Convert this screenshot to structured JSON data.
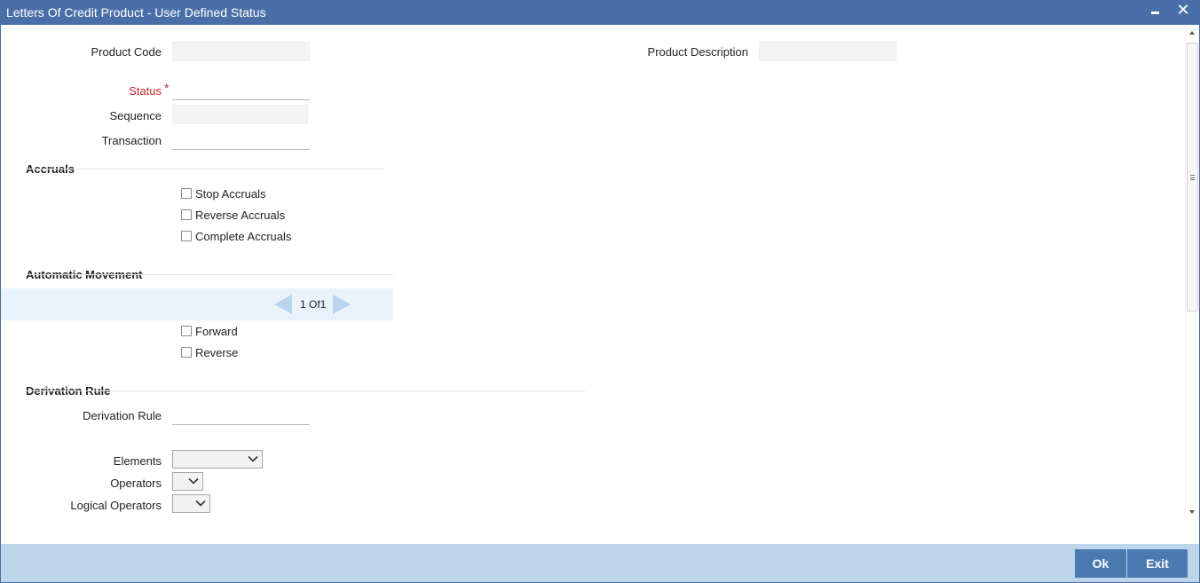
{
  "window": {
    "title": "Letters Of Credit Product - User Defined Status",
    "close_glyph": "✕"
  },
  "header_fields": {
    "product_code_label": "Product Code",
    "product_code_value": "",
    "product_description_label": "Product Description",
    "product_description_value": ""
  },
  "status_fields": {
    "status_label": "Status",
    "status_required": "*",
    "status_value": "",
    "sequence_label": "Sequence",
    "sequence_value": "",
    "transaction_label": "Transaction",
    "transaction_value": ""
  },
  "accruals": {
    "title": "Accruals",
    "options": [
      {
        "label": "Stop Accruals",
        "checked": false
      },
      {
        "label": "Reverse Accruals",
        "checked": false
      },
      {
        "label": "Complete Accruals",
        "checked": false
      }
    ]
  },
  "automatic_movement": {
    "title": "Automatic Movement",
    "pager": {
      "current": "1",
      "separator": "Of",
      "total": "1"
    },
    "options": [
      {
        "label": "Forward",
        "checked": false
      },
      {
        "label": "Reverse",
        "checked": false
      }
    ]
  },
  "derivation_rule": {
    "title": "Derivation Rule",
    "rule_label": "Derivation Rule",
    "rule_value": "",
    "elements_label": "Elements",
    "elements_value": "",
    "operators_label": "Operators",
    "operators_value": "",
    "logical_operators_label": "Logical Operators",
    "logical_operators_value": ""
  },
  "footer": {
    "ok_label": "Ok",
    "exit_label": "Exit"
  },
  "colors": {
    "titlebar": "#4a6fa8",
    "footer": "#bdd6ec",
    "button": "#4a7bb0",
    "required": "#c0272d",
    "pager_band": "#eaf2fb"
  }
}
